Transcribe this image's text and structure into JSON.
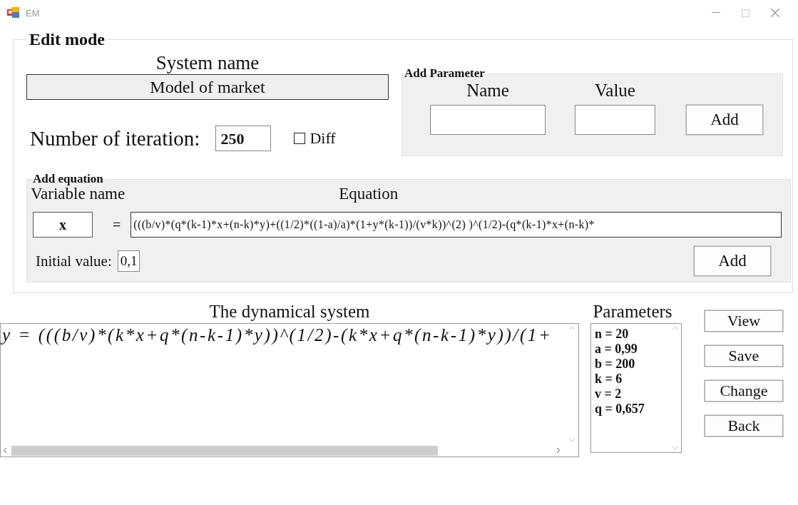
{
  "window": {
    "title": "EM"
  },
  "edit_mode": {
    "title": "Edit mode",
    "system_name_label": "System name",
    "system_name": "Model of market",
    "iterations_label": "Number of iteration:",
    "iterations": "250",
    "diff": {
      "label": "Diff",
      "checked": false
    }
  },
  "add_parameter": {
    "title": "Add  Parameter",
    "name_label": "Name",
    "value_label": "Value",
    "button": "Add"
  },
  "add_equation": {
    "title": "Add equation",
    "variable_label": "Variable name",
    "equation_label": "Equation",
    "variable": "x",
    "equals": "=",
    "equation": "(((b/v)*(q*(k-1)*x+(n-k)*y)+((1/2)*((1-a)/a)*(1+y*(k-1))/(v*k))^(2) )^(1/2)-(q*(k-1)*x+(n-k)*",
    "initial_label": "Initial value:",
    "initial": "0,1",
    "button": "Add"
  },
  "dynamical_system": {
    "title": "The dynamical system",
    "lines": [
      "y = (((b/v)*(k*x+q*(n-k-1)*y))^(1/2)-(k*x+q*(n-k-1)*y))/(1+"
    ]
  },
  "parameters": {
    "title": "Parameters",
    "items": [
      "n = 20",
      "a = 0,99",
      "b = 200",
      "k = 6",
      "v = 2",
      "q = 0,657"
    ]
  },
  "buttons": [
    "View",
    "Save",
    "Change",
    "Back"
  ]
}
